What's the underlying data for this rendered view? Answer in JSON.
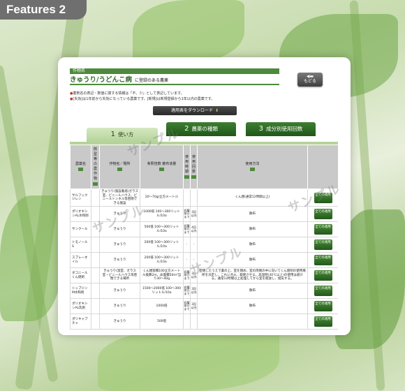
{
  "feature_tag": "Features 2",
  "header": {
    "crop_label": "作物名",
    "crop_name": "きゅうり/うどんこ病",
    "crop_subtitle": "に登録のある農薬",
    "back_button": "もどる"
  },
  "notes": [
    {
      "mark": "●",
      "text": "薬剤名の表記・数値に関する情報は「不、少」として表記しています。"
    },
    {
      "mark": "●",
      "text": "[失効]は1年前から失効になっている農薬です。[新規]は新規登録から1年以内の農薬です。"
    }
  ],
  "download_button": "適用表をダウンロード",
  "tabs": [
    {
      "num": "1",
      "label": "使い方"
    },
    {
      "num": "2",
      "label": "農薬の種類"
    },
    {
      "num": "3",
      "label": "成分別使用回数"
    }
  ],
  "table": {
    "headers": [
      "農薬名",
      "剤型等の農作物",
      "作物名／場所",
      "希釈倍数 散布液量",
      "使用時期",
      "使用回数",
      "使用方法",
      ""
    ],
    "rows": [
      {
        "name": "サルフックジレン",
        "type": "",
        "crop": "きゅうり(施設栽培)ガラス室、ビニールハウス、ビニールトンネル等密閉できる施設",
        "dilution": "20～70g/立方メートル",
        "time": "",
        "count": "",
        "method": "くん煙(通常12時間以上)",
        "button": "全ての適用"
      },
      {
        "name": "ポリオキシンAL水和剤",
        "type": "",
        "crop": "きゅうり",
        "dilution": "1000倍 100～300リットル/10a",
        "time": "収穫前日まで",
        "count": "3回以内",
        "method": "散布",
        "button": "全ての適用"
      },
      {
        "name": "サンクール",
        "type": "",
        "crop": "きゅうり",
        "dilution": "500倍 100～300リットル/10a",
        "time": "収穫前日まで",
        "count": "4回以内",
        "method": "散布",
        "button": "全ての適用"
      },
      {
        "name": "トモノール S",
        "type": "",
        "crop": "きゅうり",
        "dilution": "200倍 100～300リットル/10a",
        "time": "-",
        "count": "-",
        "method": "散布",
        "button": "全ての適用"
      },
      {
        "name": "スプレーオイル",
        "type": "",
        "crop": "きゅうり",
        "dilution": "200倍 100～300リットル/10a",
        "time": "-",
        "count": "-",
        "method": "散布",
        "button": "全ての適用"
      },
      {
        "name": "ダコニールくん煙剤",
        "type": "",
        "crop": "きゅうり(温室、ガラス室・ビニールハウス等密閉できる場所",
        "dilution": "くん煙容積100立方メートル換算2m、床面積50m²当り30～40g",
        "time": "収穫前日まで",
        "count": "3回以内",
        "method": "密閉したうえで薬の上、室を閉め、室の両側の中に向いてくん煙剤の使用場所を決定し、これに点火、発煙させる。高温時(30℃以上)の使用は避ける。通常12時間以上処理してから室を開放し、換気する。",
        "button": "全ての適用"
      },
      {
        "name": "トップジンM水和剤",
        "type": "",
        "crop": "きゅうり",
        "dilution": "1500～2000倍 100～300リットル/10a",
        "time": "収穫前日まで",
        "count": "3回以内",
        "method": "散布",
        "button": "全ての適用"
      },
      {
        "name": "ポリオキシンAL乳剤",
        "type": "",
        "crop": "きゅうり",
        "dilution": "1000倍",
        "time": "収穫前日まで",
        "count": "3回以内",
        "method": "散布",
        "button": "全ての適用"
      },
      {
        "name": "ポリキャプチャ",
        "type": "",
        "crop": "きゅうり",
        "dilution": "500倍",
        "time": "",
        "count": "",
        "method": "",
        "button": "全ての適用"
      }
    ]
  },
  "watermarks": [
    "サンプル",
    "サンプル",
    "サンプル",
    "サンプル"
  ],
  "colors": {
    "accent": "#4d8a3c",
    "tab_dark": "#1f5818",
    "tab_light": "#b5d39a",
    "header_bar": "#6f6f6f"
  }
}
